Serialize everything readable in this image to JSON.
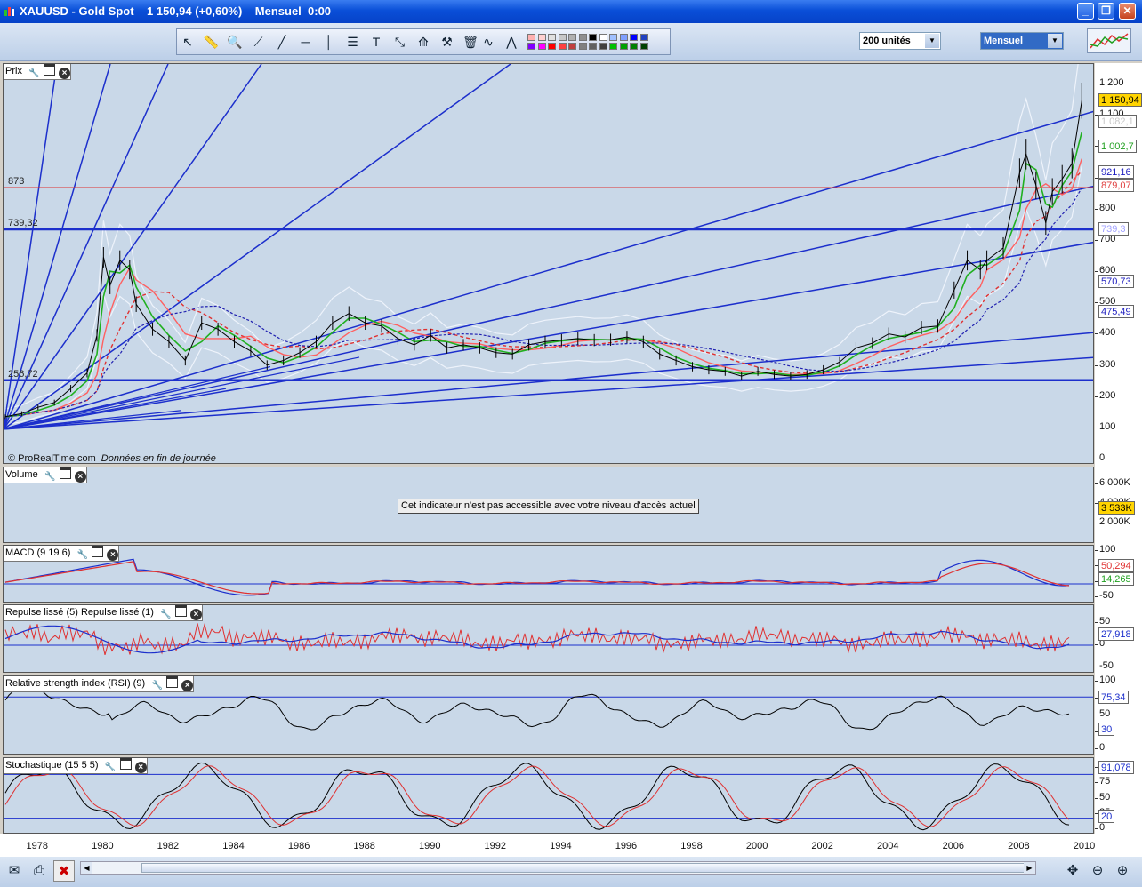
{
  "window": {
    "title": "XAUUSD - Gold Spot    1 150,94 (+0,60%)    Mensuel  0:00",
    "minimize": "_",
    "restore": "❐",
    "close": "✕"
  },
  "toolbar": {
    "units_select": "200 unités",
    "period_select": "Mensuel",
    "icons": [
      "cursor-icon",
      "ruler-icon",
      "zoom-icon",
      "point-line-icon",
      "trend-line-icon",
      "horizontal-line-icon",
      "vertical-line-icon",
      "fibonacci-icon",
      "text-icon",
      "arrows-icon",
      "fan-icon",
      "hammer-icon",
      "trash-icon",
      "curve-icon",
      "channel-icon"
    ],
    "colors": [
      "#ffb0b0",
      "#ffd0d0",
      "#e0e0e0",
      "#c8c8c8",
      "#b0b0b0",
      "#909090",
      "#000000",
      "#ffffff",
      "#a0c0ff",
      "#80a0ff",
      "#0000ff",
      "#2040c0",
      "#8000ff",
      "#ff00ff",
      "#ff0000",
      "#ff4040",
      "#c04040",
      "#808080",
      "#606060",
      "#404040",
      "#00c000",
      "#00a000",
      "#008000",
      "#004000"
    ]
  },
  "panes": {
    "price": {
      "title": "Prix"
    },
    "volume": {
      "title": "Volume",
      "message": "Cet indicateur n'est pas accessible avec votre niveau d'accès actuel",
      "tag": "3 533K"
    },
    "macd": {
      "title": "MACD (9 19 6)",
      "tags": [
        "50,294",
        "14,265"
      ]
    },
    "repulse": {
      "title": "Repulse lissé (5) Repulse lissé (1)",
      "tag": "27,918"
    },
    "rsi": {
      "title": "Relative strength index (RSI) (9)",
      "tags": [
        "75,34",
        "30"
      ]
    },
    "stoch": {
      "title": "Stochastique (15 5 5)",
      "tags": [
        "91,078",
        "20"
      ]
    }
  },
  "credits": {
    "source": "© ProRealTime.com",
    "note": "Données en fin de journée"
  },
  "price_levels": [
    {
      "label": "873",
      "value": 873
    },
    {
      "label": "739,32",
      "value": 739.32
    },
    {
      "label": "256,72",
      "value": 256.72
    }
  ],
  "price_tags": [
    {
      "text": "1 150,94",
      "value": 1150.94,
      "bg": "#ffd400",
      "fg": "#000000"
    },
    {
      "text": "1 082,1",
      "value": 1082.1,
      "bg": "#ffffff",
      "fg": "#c8c8c8"
    },
    {
      "text": "1 002,7",
      "value": 1002.7,
      "bg": "#ffffff",
      "fg": "#20a020"
    },
    {
      "text": "921,16",
      "value": 921.16,
      "bg": "#ffffff",
      "fg": "#2020c0"
    },
    {
      "text": "879,07",
      "value": 879.07,
      "bg": "#ffffff",
      "fg": "#e04040"
    },
    {
      "text": "739,3",
      "value": 739.32,
      "bg": "#ffffff",
      "fg": "#a0a0ff"
    },
    {
      "text": "570,73",
      "value": 570.73,
      "bg": "#ffffff",
      "fg": "#2020c0"
    },
    {
      "text": "475,49",
      "value": 475.49,
      "bg": "#ffffff",
      "fg": "#2020c0"
    }
  ],
  "axis_labels": {
    "price": [
      "1 200",
      "1 100",
      "1 000",
      "900",
      "800",
      "700",
      "600",
      "500",
      "400",
      "300",
      "200",
      "100",
      "0"
    ],
    "volume": [
      "6 000K",
      "4 000K",
      "2 000K"
    ],
    "macd": [
      "100",
      "50",
      "0",
      "-50"
    ],
    "repulse": [
      "50",
      "0",
      "-50"
    ],
    "rsi": [
      "100",
      "75",
      "50",
      "25",
      "0"
    ],
    "stoch": [
      "100",
      "75",
      "50",
      "25",
      "0"
    ]
  },
  "chart_data": {
    "type": "line",
    "instrument": "XAUUSD - Gold Spot",
    "timeframe": "Mensuel",
    "last": 1150.94,
    "change": "+0,60%",
    "x_ticks": [
      "1978",
      "1980",
      "1982",
      "1984",
      "1986",
      "1988",
      "1990",
      "1992",
      "1994",
      "1996",
      "1998",
      "2000",
      "2002",
      "2004",
      "2006",
      "2008",
      "2010"
    ],
    "ylim": [
      0,
      1250
    ],
    "series": [
      {
        "name": "XAUUSD",
        "x": [
          1977.0,
          1977.5,
          1978.0,
          1978.5,
          1979.0,
          1979.5,
          1979.8,
          1980.0,
          1980.2,
          1980.5,
          1980.8,
          1981.0,
          1981.5,
          1982.0,
          1982.5,
          1983.0,
          1983.5,
          1984.0,
          1984.5,
          1985.0,
          1985.5,
          1986.0,
          1986.5,
          1987.0,
          1987.5,
          1988.0,
          1988.5,
          1989.0,
          1989.5,
          1990.0,
          1990.5,
          1991.0,
          1991.5,
          1992.0,
          1992.5,
          1993.0,
          1993.5,
          1994.0,
          1994.5,
          1995.0,
          1995.5,
          1996.0,
          1996.5,
          1997.0,
          1997.5,
          1998.0,
          1998.5,
          1999.0,
          1999.5,
          2000.0,
          2000.5,
          2001.0,
          2001.5,
          2002.0,
          2002.5,
          2003.0,
          2003.5,
          2004.0,
          2004.5,
          2005.0,
          2005.5,
          2006.0,
          2006.4,
          2006.8,
          2007.0,
          2007.5,
          2008.0,
          2008.2,
          2008.5,
          2008.8,
          2009.0,
          2009.3,
          2009.6,
          2009.9
        ],
        "y": [
          140,
          150,
          170,
          185,
          230,
          280,
          400,
          650,
          560,
          640,
          610,
          500,
          420,
          380,
          320,
          440,
          420,
          380,
          350,
          305,
          320,
          345,
          380,
          440,
          470,
          440,
          430,
          390,
          370,
          400,
          360,
          370,
          360,
          345,
          340,
          370,
          380,
          385,
          390,
          385,
          386,
          395,
          380,
          340,
          320,
          300,
          290,
          285,
          270,
          285,
          275,
          270,
          275,
          290,
          315,
          360,
          375,
          405,
          395,
          425,
          430,
          545,
          640,
          610,
          640,
          680,
          920,
          980,
          880,
          760,
          860,
          900,
          950,
          1150.94
        ]
      }
    ]
  }
}
